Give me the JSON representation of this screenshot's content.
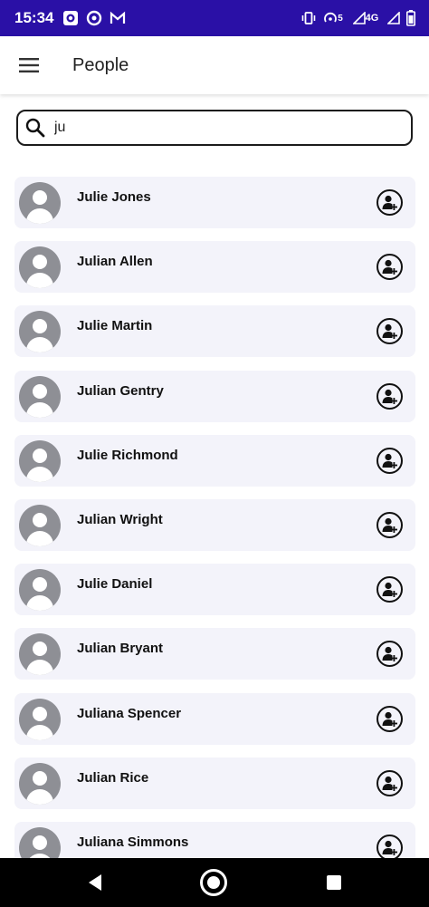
{
  "status_bar": {
    "time": "15:34",
    "icons": [
      "screen-record-icon",
      "data-saver-icon",
      "gmail-icon",
      "vibrate-icon",
      "hotspot-icon",
      "signal-icon",
      "battery-icon"
    ],
    "hotspot_count": "5",
    "network": "4G",
    "bg_color": "#2a10a6"
  },
  "app_bar": {
    "title": "People"
  },
  "search": {
    "value": "ju"
  },
  "people": [
    {
      "name": "Julie Jones"
    },
    {
      "name": "Julian Allen"
    },
    {
      "name": "Julie Martin"
    },
    {
      "name": "Julian Gentry"
    },
    {
      "name": "Julie Richmond"
    },
    {
      "name": "Julian Wright"
    },
    {
      "name": "Julie Daniel"
    },
    {
      "name": "Julian Bryant"
    },
    {
      "name": "Juliana Spencer"
    },
    {
      "name": "Julian Rice"
    },
    {
      "name": "Juliana Simmons"
    }
  ],
  "nav_bar": {
    "icons": [
      "back-icon",
      "home-icon",
      "recents-icon"
    ]
  }
}
